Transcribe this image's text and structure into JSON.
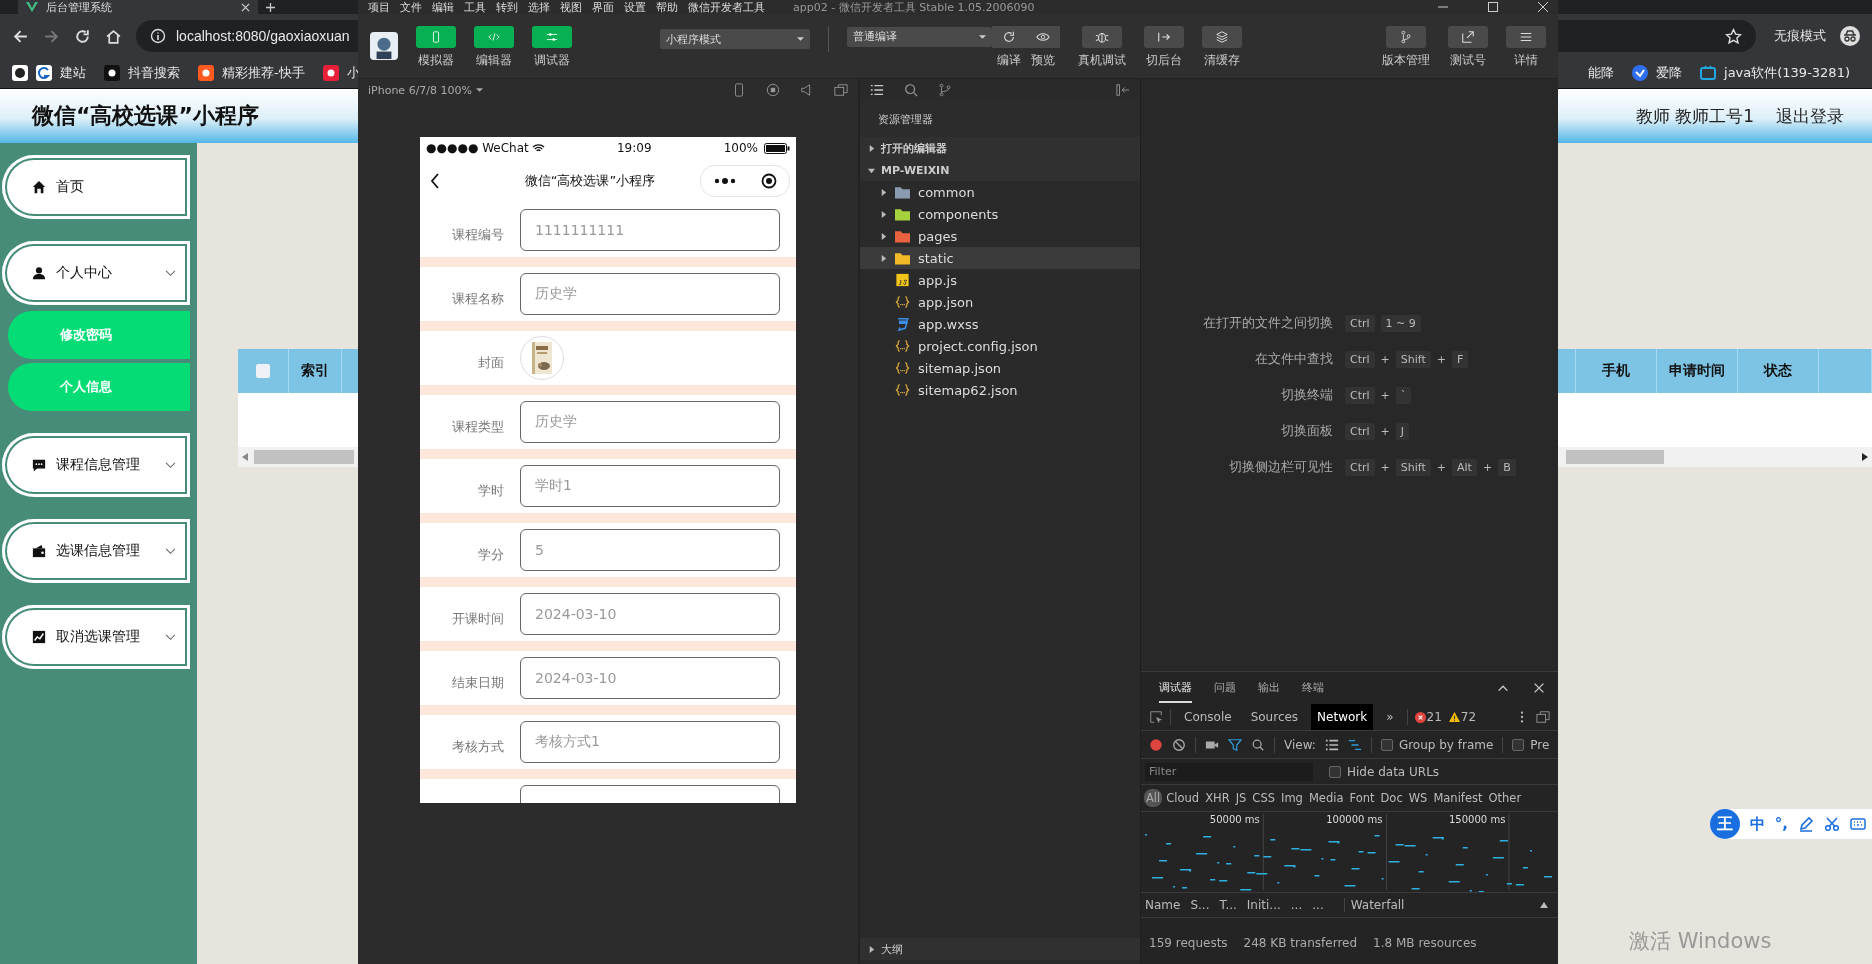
{
  "browser": {
    "tab_title": "后台管理系统",
    "url": "localhost:8080/gaoxiaoxuan",
    "mode_label": "无痕模式",
    "bookmarks_left": [
      "建站",
      "抖音搜索",
      "精彩推荐-快手",
      "小"
    ],
    "bookmarks_right": [
      "能降",
      "爱降",
      "java软件(139-3281)"
    ]
  },
  "admin": {
    "title": "微信“高校选课”小程序",
    "user": "教师 教师工号1",
    "logout": "退出登录",
    "menu": [
      {
        "label": "首页",
        "kind": "link"
      },
      {
        "label": "个人中心",
        "kind": "group",
        "children": [
          {
            "label": "修改密码"
          },
          {
            "label": "个人信息"
          }
        ]
      },
      {
        "label": "课程信息管理",
        "kind": "group"
      },
      {
        "label": "选课信息管理",
        "kind": "group"
      },
      {
        "label": "取消选课管理",
        "kind": "group"
      }
    ],
    "table": {
      "select_all": {
        "checked": false
      },
      "columns_left": [
        "索引"
      ],
      "columns_right": [
        "手机",
        "申请时间",
        "状态"
      ]
    }
  },
  "devtools": {
    "menu": [
      "项目",
      "文件",
      "编辑",
      "工具",
      "转到",
      "选择",
      "视图",
      "界面",
      "设置",
      "帮助",
      "微信开发者工具"
    ],
    "title": "app02 - 微信开发者工具 Stable 1.05.2006090",
    "views": [
      {
        "label": "模拟器",
        "on": true
      },
      {
        "label": "编辑器",
        "on": true
      },
      {
        "label": "调试器",
        "on": true
      }
    ],
    "mode_select": "小程序模式",
    "compile_select": "普通编译",
    "actions": [
      "编译",
      "预览",
      "真机调试",
      "切后台",
      "清缓存"
    ],
    "right_actions": [
      "版本管理",
      "测试号",
      "详情"
    ],
    "device": "iPhone 6/7/8 100%",
    "phone": {
      "carrier": "●●●●● WeChat",
      "time": "19:09",
      "battery": "100%",
      "nav_title": "微信“高校选课”小程序",
      "fields": [
        {
          "label": "课程编号",
          "kind": "input",
          "value": "1111111111"
        },
        {
          "label": "课程名称",
          "kind": "input",
          "value": "历史学"
        },
        {
          "label": "封面"
        },
        {
          "label": "课程类型",
          "kind": "input",
          "value": "历史学"
        },
        {
          "label": "学时",
          "kind": "input",
          "value": "学时1"
        },
        {
          "label": "学分",
          "kind": "input",
          "value": "5"
        },
        {
          "label": "开课时间",
          "kind": "input",
          "value": "2024-03-10"
        },
        {
          "label": "结束日期",
          "kind": "input",
          "value": "2024-03-10"
        },
        {
          "label": "考核方式",
          "kind": "input",
          "value": "考核方式1"
        },
        {
          "kind": "input"
        }
      ]
    },
    "explorer": {
      "title": "资源管理器",
      "sections": [
        {
          "label": "打开的编辑器",
          "expanded": false
        },
        {
          "label": "MP-WEIXIN",
          "expanded": true
        }
      ],
      "files": [
        {
          "name": "common",
          "kind": "folder",
          "color": "#8a9bb0",
          "selected": false
        },
        {
          "name": "components",
          "kind": "folder",
          "color": "#a6d13c",
          "selected": false
        },
        {
          "name": "pages",
          "kind": "folder",
          "color": "#e8623f",
          "selected": false
        },
        {
          "name": "static",
          "kind": "folder",
          "color": "#f2b928",
          "selected": true
        },
        {
          "name": "app.js",
          "kind": "js",
          "selected": false
        },
        {
          "name": "app.json",
          "kind": "json",
          "selected": false
        },
        {
          "name": "app.wxss",
          "kind": "wxss",
          "selected": false
        },
        {
          "name": "project.config.json",
          "kind": "json",
          "selected": false
        },
        {
          "name": "sitemap.json",
          "kind": "json",
          "selected": false
        },
        {
          "name": "sitemap62.json",
          "kind": "json",
          "selected": false
        }
      ],
      "outline": "大纲"
    },
    "shortcuts": [
      {
        "label": "在打开的文件之间切换",
        "parts": [
          {
            "key": "Ctrl"
          },
          {
            "key": "1 ~ 9"
          }
        ]
      },
      {
        "label": "在文件中查找",
        "parts": [
          {
            "key": "Ctrl"
          },
          {
            "sep": "+"
          },
          {
            "key": "Shift"
          },
          {
            "sep": "+"
          },
          {
            "key": "F"
          }
        ]
      },
      {
        "label": "切换终端",
        "parts": [
          {
            "key": "Ctrl"
          },
          {
            "sep": "+"
          },
          {
            "key": "`"
          }
        ]
      },
      {
        "label": "切换面板",
        "parts": [
          {
            "key": "Ctrl"
          },
          {
            "sep": "+"
          },
          {
            "key": "J"
          }
        ]
      },
      {
        "label": "切换侧边栏可见性",
        "parts": [
          {
            "key": "Ctrl"
          },
          {
            "sep": "+"
          },
          {
            "key": "Shift"
          },
          {
            "sep": "+"
          },
          {
            "key": "Alt"
          },
          {
            "sep": "+"
          },
          {
            "key": "B"
          }
        ]
      }
    ],
    "debugger": {
      "tabs": [
        {
          "label": "调试器",
          "selected": true
        },
        {
          "label": "问题",
          "selected": false
        },
        {
          "label": "输出",
          "selected": false
        },
        {
          "label": "终端",
          "selected": false
        }
      ],
      "panels": [
        {
          "label": "Console",
          "selected": false
        },
        {
          "label": "Sources",
          "selected": false
        },
        {
          "label": "Network",
          "selected": true
        }
      ],
      "more": "»",
      "errors": "21",
      "warnings": "72",
      "recording": true,
      "view_label": "View:",
      "group_by_frame": {
        "label": "Group by frame",
        "checked": false
      },
      "preserve": {
        "label": "Pre",
        "checked": false
      },
      "filter_placeholder": "Filter",
      "hide_data_urls": {
        "label": "Hide data URLs",
        "checked": false
      },
      "types": [
        {
          "label": "All",
          "selected": true
        },
        {
          "label": "Cloud",
          "selected": false
        },
        {
          "label": "XHR",
          "selected": false
        },
        {
          "label": "JS",
          "selected": false
        },
        {
          "label": "CSS",
          "selected": false
        },
        {
          "label": "Img",
          "selected": false
        },
        {
          "label": "Media",
          "selected": false
        },
        {
          "label": "Font",
          "selected": false
        },
        {
          "label": "Doc",
          "selected": false
        },
        {
          "label": "WS",
          "selected": false
        },
        {
          "label": "Manifest",
          "selected": false
        },
        {
          "label": "Other",
          "selected": false
        }
      ],
      "timeline_ticks": [
        "50000 ms",
        "100000 ms",
        "150000 ms"
      ],
      "columns": [
        "Name",
        "S...",
        "T...",
        "Initi...",
        "...",
        "...",
        "Waterfall"
      ],
      "summary": [
        "159 requests",
        "248 KB transferred",
        "1.8 MB resources"
      ]
    }
  },
  "ime": {
    "logo": "王",
    "mode": "中",
    "punct": "°,"
  },
  "activation": "激活 Windows"
}
